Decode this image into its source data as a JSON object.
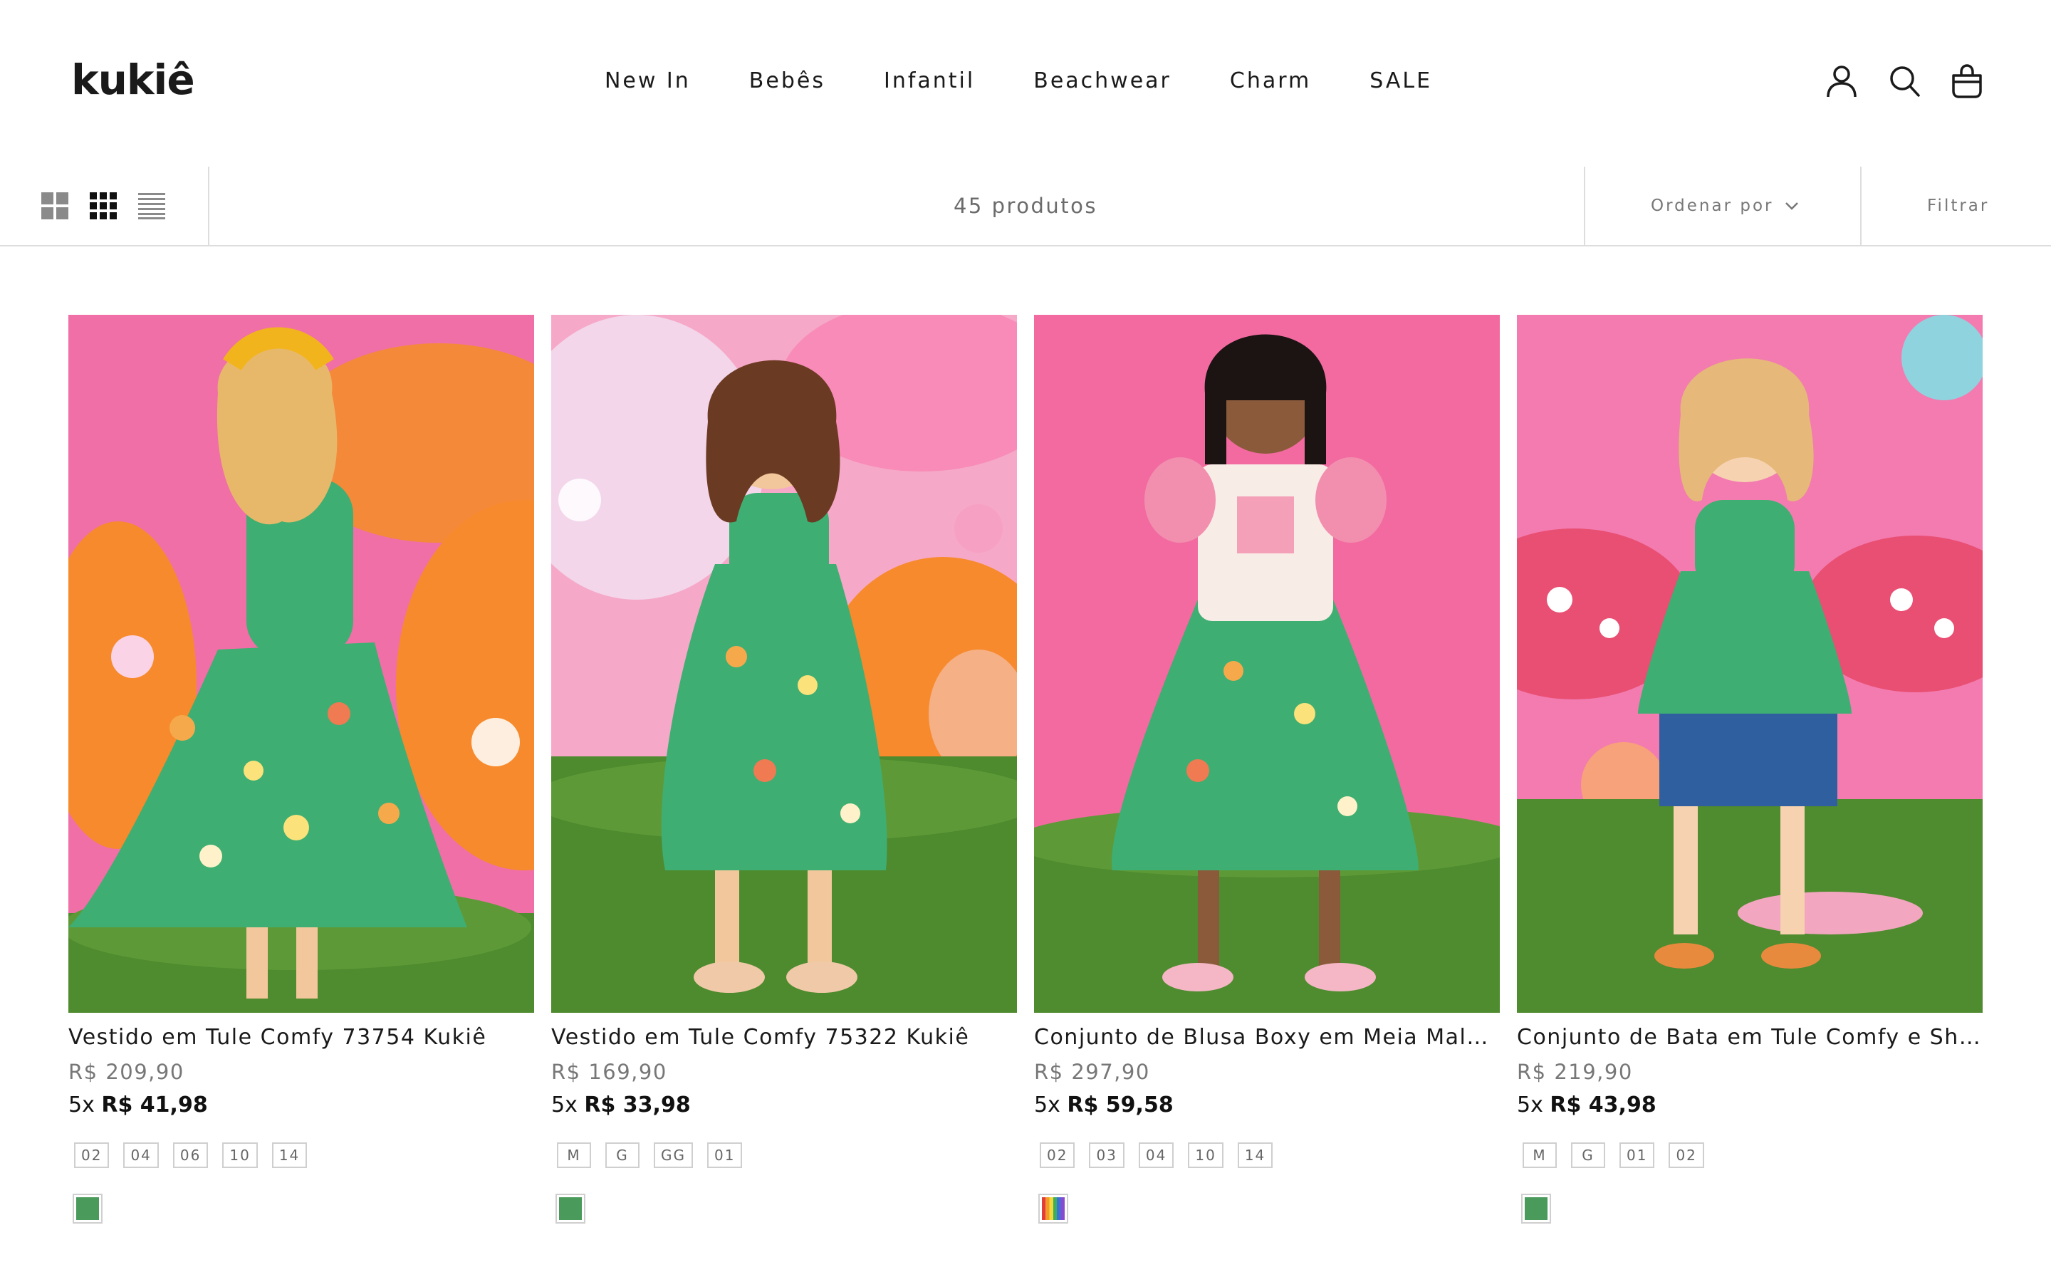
{
  "brand": {
    "logo_text": "kukiê"
  },
  "nav": {
    "items": [
      "New In",
      "Bebês",
      "Infantil",
      "Beachwear",
      "Charm",
      "SALE"
    ]
  },
  "header_icons": [
    "account-icon",
    "search-icon",
    "bag-icon"
  ],
  "toolbar": {
    "view_modes": [
      "grid-large-icon",
      "grid-small-icon",
      "list-icon"
    ],
    "product_count": "45 produtos",
    "sort_label": "Ordenar por",
    "filter_label": "Filtrar"
  },
  "colors": {
    "swatch_green": "#4a9a5c",
    "text": "#1a1a1a",
    "muted": "#777777",
    "border": "#dddddd"
  },
  "products": [
    {
      "title": "Vestido em Tule Comfy 73754 Kukiê",
      "price": "R$ 209,90",
      "installment_prefix": "5x ",
      "installment_value": "R$ 41,98",
      "sizes": [
        "02",
        "04",
        "06",
        "10",
        "14"
      ],
      "swatches": [
        "green"
      ]
    },
    {
      "title": "Vestido em Tule Comfy 75322 Kukiê",
      "price": "R$ 169,90",
      "installment_prefix": "5x ",
      "installment_value": "R$ 33,98",
      "sizes": [
        "M",
        "G",
        "GG",
        "01"
      ],
      "swatches": [
        "green"
      ]
    },
    {
      "title": "Conjunto de Blusa Boxy em Meia Malha e Vestido",
      "price": "R$ 297,90",
      "installment_prefix": "5x ",
      "installment_value": "R$ 59,58",
      "sizes": [
        "02",
        "03",
        "04",
        "10",
        "14"
      ],
      "swatches": [
        "rainbow"
      ]
    },
    {
      "title": "Conjunto de Bata em Tule Comfy e Shorts",
      "price": "R$ 219,90",
      "installment_prefix": "5x ",
      "installment_value": "R$ 43,98",
      "sizes": [
        "M",
        "G",
        "01",
        "02"
      ],
      "swatches": [
        "green"
      ]
    }
  ]
}
